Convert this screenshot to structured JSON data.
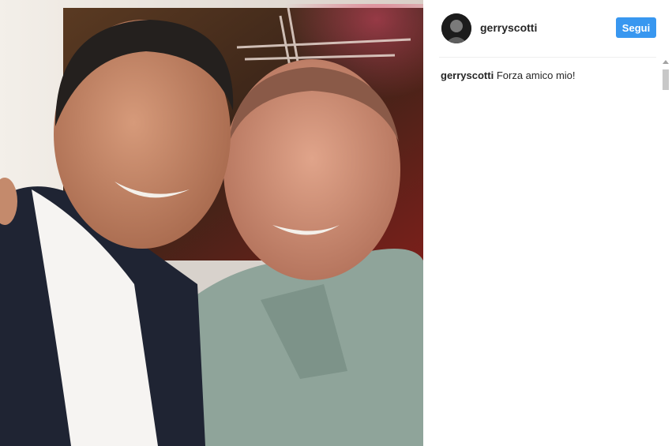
{
  "post": {
    "photo_icon": "photo",
    "author": {
      "username": "gerryscotti",
      "avatar_icon": "avatar"
    },
    "follow_label": "Segui",
    "caption": {
      "username": "gerryscotti",
      "text": "Forza amico mio!"
    }
  },
  "colors": {
    "accent": "#3897f0",
    "text": "#262626",
    "divider": "#efefef"
  }
}
